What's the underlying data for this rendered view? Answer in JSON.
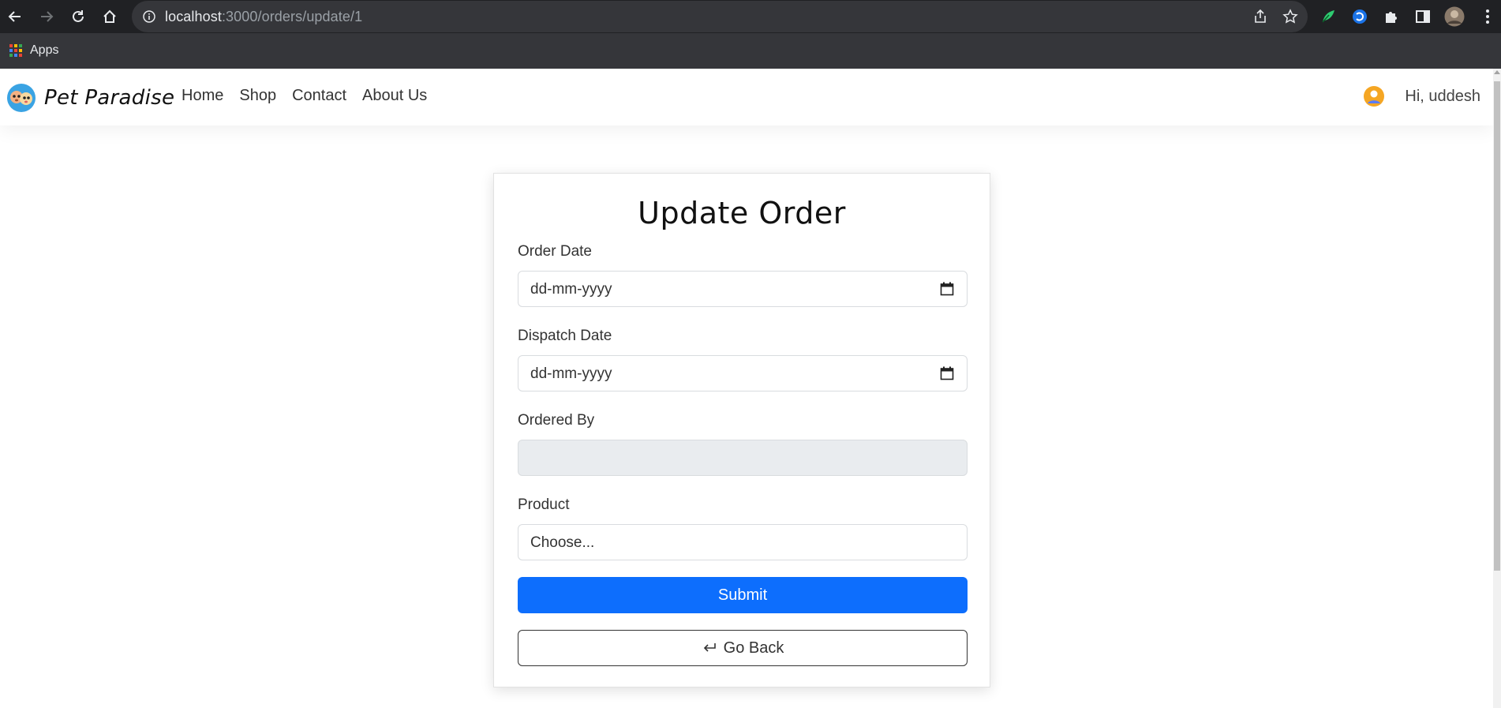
{
  "browser": {
    "url_host": "localhost",
    "url_path": ":3000/orders/update/1",
    "bookmarks_apps_label": "Apps"
  },
  "navbar": {
    "brand": "Pet Paradise",
    "links": [
      "Home",
      "Shop",
      "Contact",
      "About Us"
    ],
    "greeting": "Hi, uddesh"
  },
  "form": {
    "title": "Update Order",
    "order_date": {
      "label": "Order Date",
      "placeholder": "dd-mm-yyyy"
    },
    "dispatch_date": {
      "label": "Dispatch Date",
      "placeholder": "dd-mm-yyyy"
    },
    "ordered_by": {
      "label": "Ordered By",
      "value": ""
    },
    "product": {
      "label": "Product",
      "selected": "Choose..."
    },
    "submit_label": "Submit",
    "back_label": "Go Back"
  },
  "colors": {
    "primary": "#0d6efd",
    "chrome_dark": "#202124",
    "disabled_field": "#e9ecef"
  }
}
